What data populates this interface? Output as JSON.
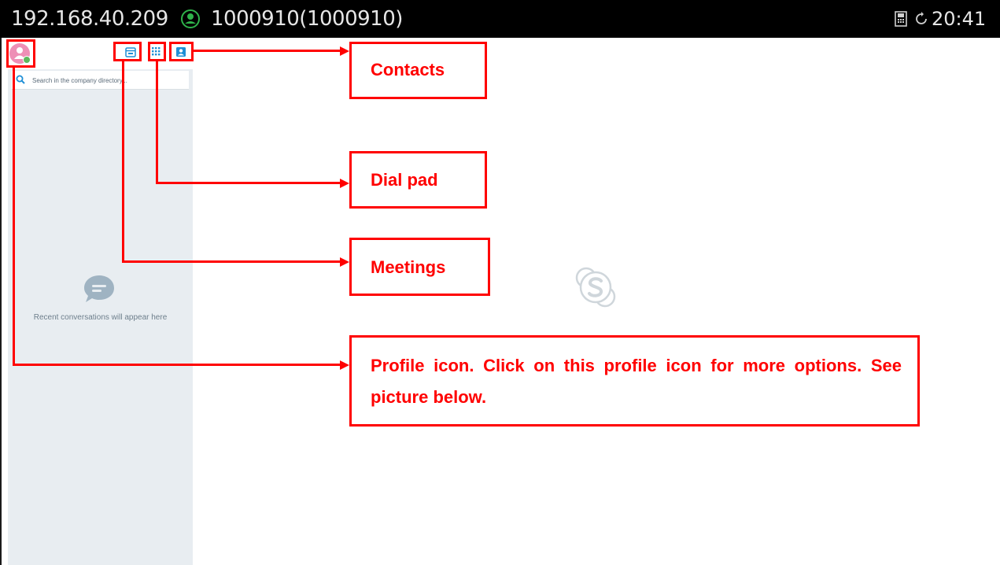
{
  "status_bar": {
    "ip_address": "192.168.40.209",
    "account": "1000910(1000910)",
    "time": "20:41",
    "icons": [
      "account-status-icon",
      "phone-icon",
      "sync-icon"
    ]
  },
  "sidebar": {
    "search_placeholder": "Search in the company directory...",
    "empty_state_text": "Recent conversations will appear here",
    "toolbar_icons": [
      "meetings-icon",
      "dialpad-icon",
      "contacts-icon"
    ]
  },
  "annotations": {
    "contacts": "Contacts",
    "dial_pad": "Dial pad",
    "meetings": "Meetings",
    "profile": "Profile icon. Click on this profile icon for more options. See picture below."
  },
  "colors": {
    "annotation": "#ff0000",
    "status_bar": "#000000",
    "sidebar_bg": "#e8edf1",
    "avatar": "#ee8fb6",
    "presence_available": "#5cb85c",
    "accent": "#1e8fd6"
  }
}
